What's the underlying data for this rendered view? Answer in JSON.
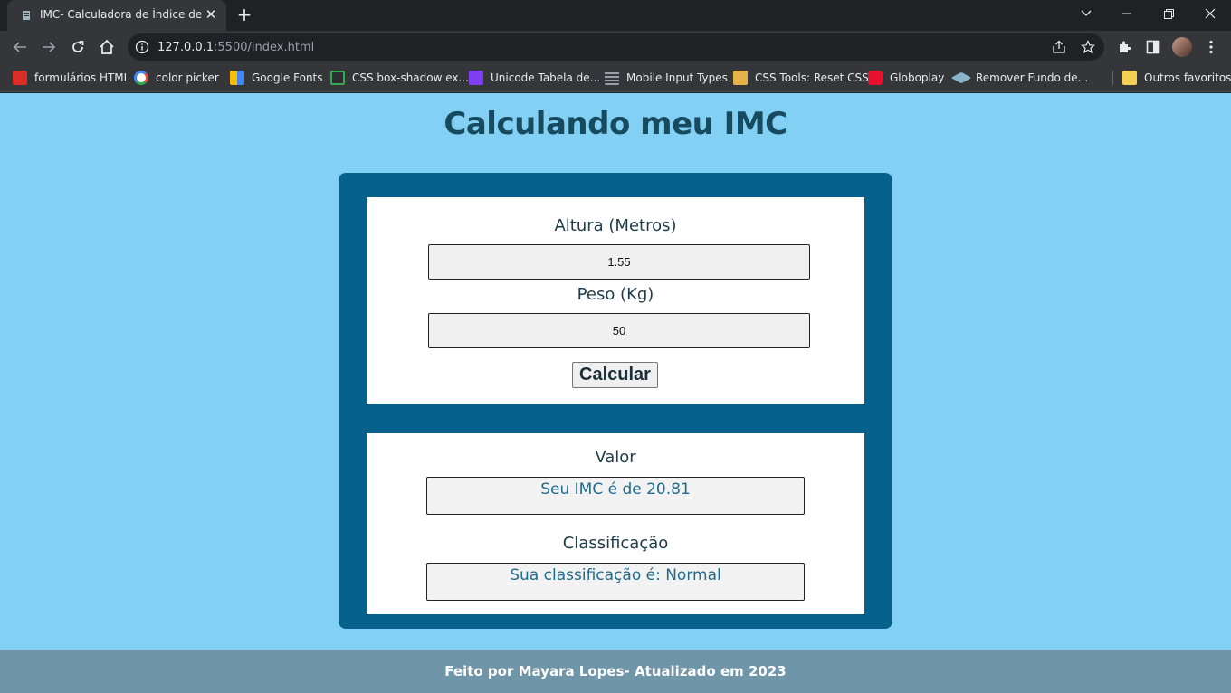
{
  "browser": {
    "tab_title": "IMC- Calculadora de Índice de Massa Corporal",
    "url_host": "127.0.0.1",
    "url_rest": ":5500/index.html",
    "bookmarks": [
      {
        "label": "formulários HTML",
        "icon": "form-icon",
        "color": "#d93025"
      },
      {
        "label": "color picker",
        "icon": "google-icon",
        "color": "#ffffff"
      },
      {
        "label": "Google Fonts",
        "icon": "google-fonts-icon",
        "color": "#4285f4"
      },
      {
        "label": "CSS box-shadow ex...",
        "icon": "css-box-shadow-icon",
        "color": "#34a853"
      },
      {
        "label": "Unicode Tabela de...",
        "icon": "unicode-icon",
        "color": "#7e3ff2"
      },
      {
        "label": "Mobile Input Types",
        "icon": "mobile-input-icon",
        "color": "#9aa0a6"
      },
      {
        "label": "CSS Tools: Reset CSS",
        "icon": "css-tools-icon",
        "color": "#e6b24a"
      },
      {
        "label": "Globoplay",
        "icon": "globoplay-icon",
        "color": "#e8112d"
      },
      {
        "label": "Remover Fundo de...",
        "icon": "remove-bg-icon",
        "color": "#8ab4c8"
      }
    ],
    "other_bookmarks": "Outros favoritos"
  },
  "page": {
    "title": "Calculando meu IMC",
    "height_label": "Altura (Metros)",
    "height_value": "1.55",
    "weight_label": "Peso (Kg)",
    "weight_value": "50",
    "calculate_label": "Calcular",
    "value_label": "Valor",
    "value_output": "Seu IMC é de 20.81",
    "classification_label": "Classificação",
    "classification_output": "Sua classificação é: Normal",
    "footer": "Feito por Mayara Lopes- Atualizado em 2023"
  },
  "colors": {
    "page_background": "#82d0f4",
    "container": "#06628d",
    "title": "#184a5f",
    "footer": "#6e95a8"
  }
}
